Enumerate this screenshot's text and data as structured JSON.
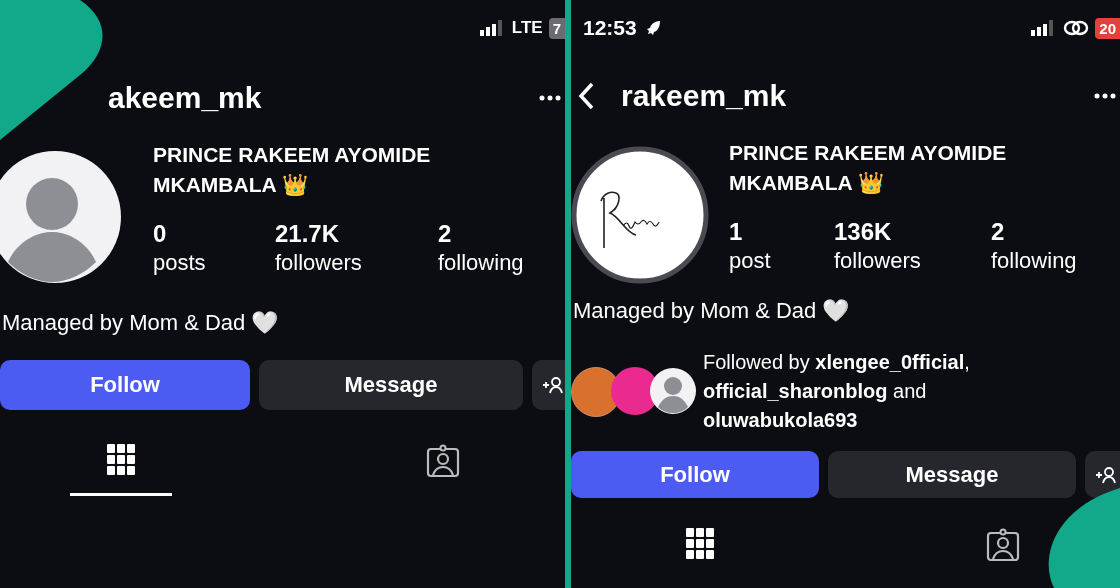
{
  "panels": [
    {
      "status_bar": {
        "network": "LTE",
        "battery": {
          "text": "7",
          "color": "#6b6b70"
        }
      },
      "username": "akeem_mk",
      "display_name": "PRINCE RAKEEM AYOMIDE MKAMBALA 👑",
      "stats": [
        {
          "value": "0",
          "label": "posts"
        },
        {
          "value": "21.7K",
          "label": "followers"
        },
        {
          "value": "2",
          "label": "following"
        }
      ],
      "bio": "Managed by Mom & Dad 🤍",
      "buttons": [
        "Follow",
        "Message"
      ],
      "tabs": [
        {
          "kind": "grid",
          "selected": true
        },
        {
          "kind": "tagged",
          "selected": false
        }
      ]
    },
    {
      "status_bar": {
        "time": "12:53",
        "battery": {
          "text": "20",
          "color": "#e5413b"
        }
      },
      "back_button": true,
      "username": "rakeem_mk",
      "display_name": "PRINCE RAKEEM AYOMIDE MKAMBALA 👑",
      "stats": [
        {
          "value": "1",
          "label": "post"
        },
        {
          "value": "136K",
          "label": "followers"
        },
        {
          "value": "2",
          "label": "following"
        }
      ],
      "bio": "Managed by Mom & Dad 🤍",
      "followed_by": "Followed by **xlengee_0fficial**, **official_sharonblog** and **oluwabukola693**",
      "buttons": [
        "Follow",
        "Message"
      ],
      "tabs": [
        {
          "kind": "grid",
          "selected": false
        },
        {
          "kind": "tagged",
          "selected": false
        }
      ]
    }
  ]
}
